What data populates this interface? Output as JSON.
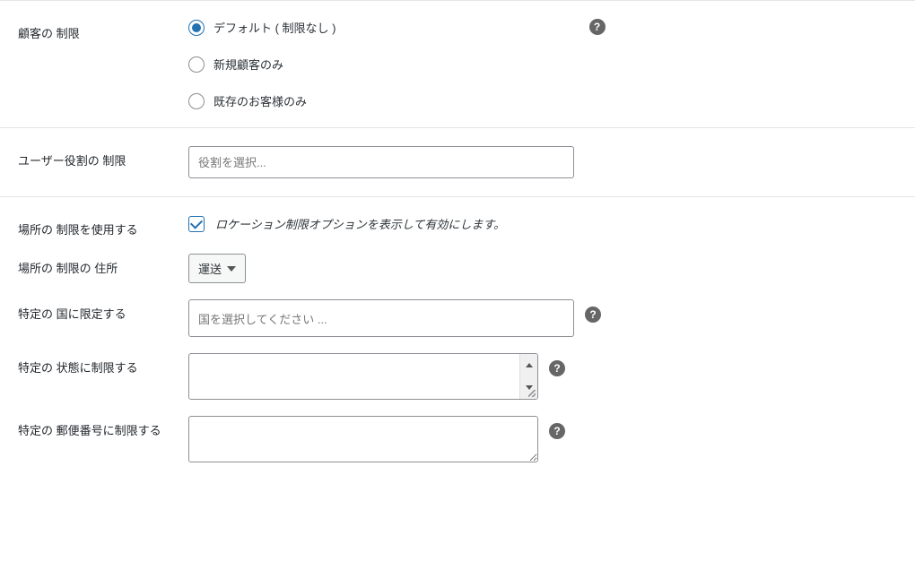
{
  "customer_restriction": {
    "label": "顧客の 制限",
    "options": {
      "default": "デフォルト ( 制限なし )",
      "new_only": "新規顧客のみ",
      "existing_only": "既存のお客様のみ"
    },
    "selected": "default"
  },
  "user_role_restriction": {
    "label": "ユーザー役割の 制限",
    "placeholder": "役割を選択..."
  },
  "use_location_restriction": {
    "label": "場所の 制限を使用する",
    "checkbox_label": "ロケーション制限オプションを表示して有効にします。",
    "checked": true
  },
  "location_restriction_address": {
    "label": "場所の 制限の 住所",
    "selected": "運送"
  },
  "restrict_countries": {
    "label": "特定の 国に限定する",
    "placeholder": "国を選択してください ..."
  },
  "restrict_states": {
    "label": "特定の 状態に制限する",
    "value": ""
  },
  "restrict_postcodes": {
    "label": "特定の 郵便番号に制限する",
    "value": ""
  },
  "help_glyph": "?"
}
